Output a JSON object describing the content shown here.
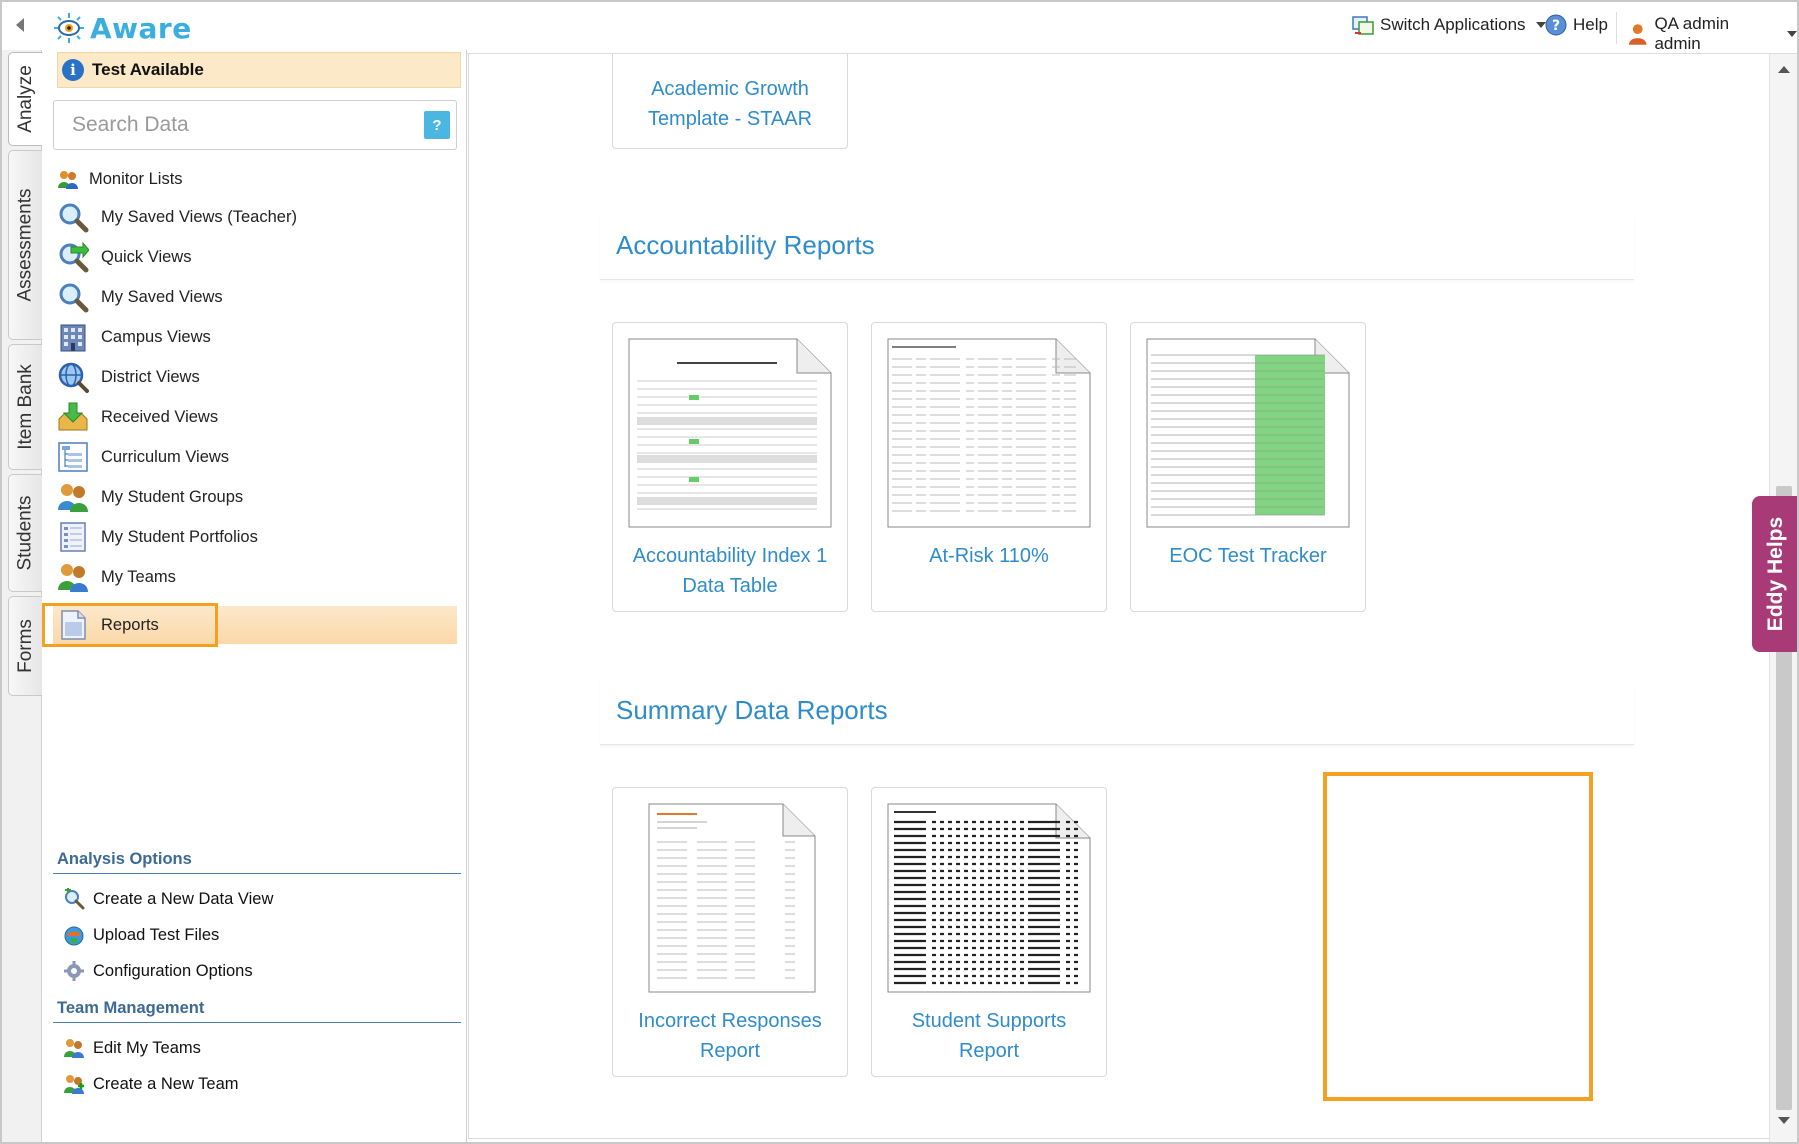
{
  "header": {
    "brand": "Aware",
    "switch_applications": "Switch Applications",
    "help": "Help",
    "user": "QA admin admin"
  },
  "vtabs": [
    "Analyze",
    "Assessments",
    "Item Bank",
    "Students",
    "Forms"
  ],
  "sidebar": {
    "test_available": "Test Available",
    "search_placeholder": "Search Data",
    "search_help": "?",
    "items": [
      {
        "label": "Monitor Lists",
        "icon": "monitor-lists-icon"
      },
      {
        "label": "My Saved Views (Teacher)",
        "icon": "magnifier-icon"
      },
      {
        "label": "Quick Views",
        "icon": "quick-views-icon"
      },
      {
        "label": "My Saved Views",
        "icon": "magnifier-icon"
      },
      {
        "label": "Campus Views",
        "icon": "building-icon"
      },
      {
        "label": "District Views",
        "icon": "globe-search-icon"
      },
      {
        "label": "Received Views",
        "icon": "inbox-download-icon"
      },
      {
        "label": "Curriculum Views",
        "icon": "curriculum-tree-icon"
      },
      {
        "label": "My Student Groups",
        "icon": "student-groups-icon"
      },
      {
        "label": "My Student Portfolios",
        "icon": "portfolio-icon"
      },
      {
        "label": "My Teams",
        "icon": "teams-icon"
      },
      {
        "label": "Reports",
        "icon": "report-page-icon"
      }
    ],
    "analysis_options_title": "Analysis Options",
    "analysis_options": [
      {
        "label": "Create a New Data View",
        "icon": "add-view-icon"
      },
      {
        "label": "Upload Test Files",
        "icon": "upload-icon"
      },
      {
        "label": "Configuration Options",
        "icon": "gear-icon"
      }
    ],
    "team_management_title": "Team Management",
    "team_management": [
      {
        "label": "Edit My Teams",
        "icon": "team-edit-icon"
      },
      {
        "label": "Create a New Team",
        "icon": "team-add-icon"
      }
    ]
  },
  "main": {
    "top_card": {
      "label_line1": "Academic Growth",
      "label_line2": "Template - STAAR"
    },
    "groups": [
      {
        "title": "Accountability Reports",
        "cards": [
          {
            "line1": "Accountability Index 1",
            "line2": "Data Table"
          },
          {
            "line1": "At-Risk 110%",
            "line2": ""
          },
          {
            "line1": "EOC Test Tracker",
            "line2": ""
          }
        ]
      },
      {
        "title": "Summary Data Reports",
        "cards": [
          {
            "line1": "Incorrect Responses",
            "line2": "Report"
          },
          {
            "line1": "Student Supports",
            "line2": "Report"
          }
        ]
      }
    ]
  },
  "eddy": "Eddy Helps",
  "colors": {
    "accent_blue": "#2f8ccb",
    "highlight_orange": "#f4a020",
    "eddy_purple": "#a83a78",
    "selected_row": "#fbd8a8"
  }
}
